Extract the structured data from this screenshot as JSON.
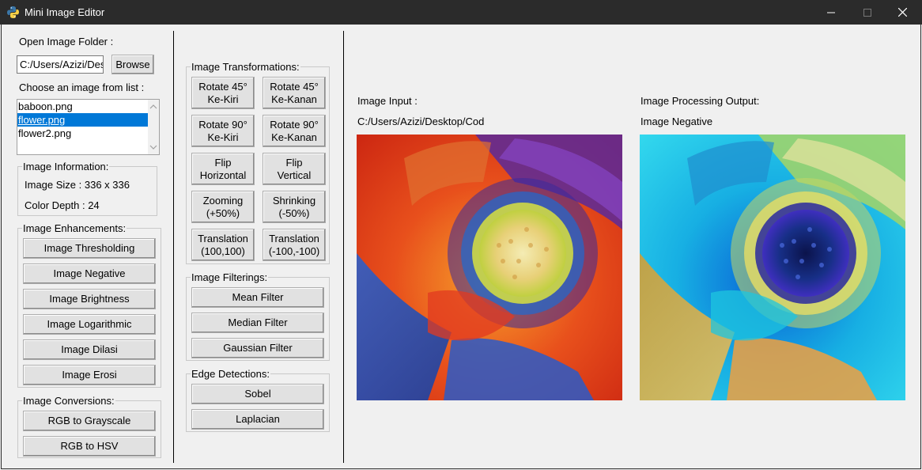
{
  "window": {
    "title": "Mini Image Editor",
    "icon": "python-icon",
    "controls": [
      "minimize-icon",
      "maximize-icon",
      "close-icon"
    ]
  },
  "left_panel": {
    "folder_label": "Open Image Folder :",
    "folder_path": "C:/Users/Azizi/Des",
    "browse_label": "Browse",
    "choose_label": "Choose an image from list :",
    "files": [
      "baboon.png",
      "flower.png",
      "flower2.png"
    ],
    "selected_file": "flower.png",
    "info": {
      "title": "Image Information:",
      "size": "Image Size : 336 x 336",
      "depth": "Color Depth : 24"
    },
    "enhancements": {
      "title": "Image Enhancements:",
      "buttons": [
        "Image Thresholding",
        "Image Negative",
        "Image Brightness",
        "Image Logarithmic",
        "Image Dilasi",
        "Image Erosi"
      ]
    },
    "conversions": {
      "title": "Image Conversions:",
      "buttons": [
        "RGB to Grayscale",
        "RGB to HSV"
      ]
    }
  },
  "middle_panel": {
    "transformations": {
      "title": "Image Transformations:",
      "buttons": [
        "Rotate 45°\nKe-Kiri",
        "Rotate 45°\nKe-Kanan",
        "Rotate 90°\nKe-Kiri",
        "Rotate 90°\nKe-Kanan",
        "Flip\nHorizontal",
        "Flip\nVertical",
        "Zooming\n(+50%)",
        "Shrinking\n(-50%)",
        "Translation\n(100,100)",
        "Translation\n(-100,-100)"
      ]
    },
    "filterings": {
      "title": "Image Filterings:",
      "buttons": [
        "Mean Filter",
        "Median Filter",
        "Gaussian Filter"
      ]
    },
    "edges": {
      "title": "Edge Detections:",
      "buttons": [
        "Sobel",
        "Laplacian"
      ]
    }
  },
  "right_panel": {
    "input_label": "Image Input :",
    "input_path": "C:/Users/Azizi/Desktop/Cod",
    "output_label": "Image Processing Output:",
    "output_operation": "Image Negative"
  },
  "colors": {
    "titlebar": "#2b2b2b",
    "selection": "#0078d7",
    "window_bg": "#f0f0f0"
  }
}
